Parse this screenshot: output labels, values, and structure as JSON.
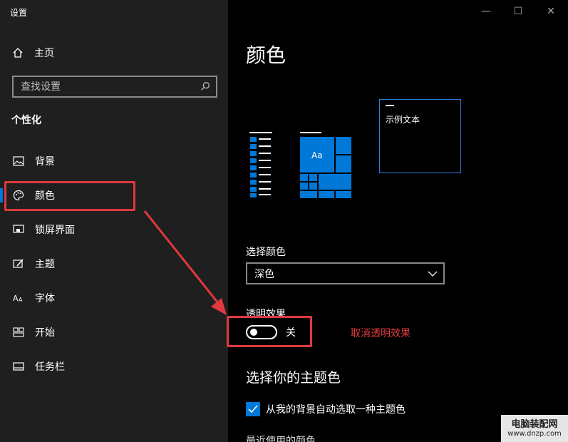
{
  "app": {
    "title": "设置"
  },
  "window": {
    "minimize": "—",
    "maximize": "☐",
    "close": "✕"
  },
  "sidebar": {
    "home_label": "主页",
    "search_placeholder": "查找设置",
    "section_title": "个性化",
    "items": [
      {
        "label": "背景",
        "icon": "image-icon"
      },
      {
        "label": "颜色",
        "icon": "palette-icon",
        "active": true
      },
      {
        "label": "锁屏界面",
        "icon": "lockscreen-icon"
      },
      {
        "label": "主题",
        "icon": "theme-brush-icon"
      },
      {
        "label": "字体",
        "icon": "font-icon"
      },
      {
        "label": "开始",
        "icon": "start-tiles-icon"
      },
      {
        "label": "任务栏",
        "icon": "taskbar-icon"
      }
    ]
  },
  "main": {
    "title": "颜色",
    "preview_sample_text": "示例文本",
    "preview_tile_text": "Aa",
    "choose_color_label": "选择颜色",
    "choose_color_value": "深色",
    "transparency_label": "透明效果",
    "transparency_state": "关",
    "transparency_on": false,
    "annotation": "取消透明效果",
    "accent_heading": "选择你的主题色",
    "auto_accent_label": "从我的背景自动选取一种主题色",
    "auto_accent_checked": true,
    "recent_colors_label": "最近使用的颜色"
  },
  "watermark": {
    "line1": "电脑装配网",
    "line2": "www.dnzp.com"
  },
  "colors": {
    "accent": "#0078d7",
    "annotation": "#e0393e",
    "sidebar_bg": "#1f1f1f",
    "main_bg": "#000000"
  }
}
